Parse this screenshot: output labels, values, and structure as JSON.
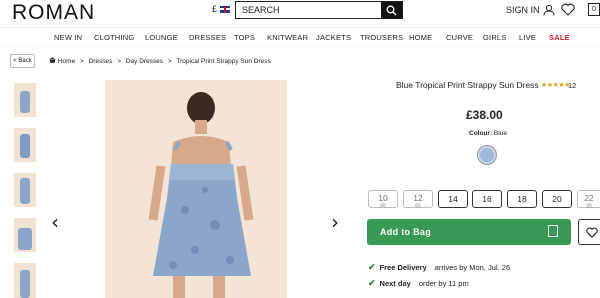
{
  "header": {
    "logo": "ROMAN",
    "currency": "£",
    "search_placeholder": "SEARCH",
    "signin": "SIGN IN",
    "bag_count": "0"
  },
  "nav": [
    "NEW IN",
    "CLOTHING",
    "LOUNGE",
    "DRESSES",
    "TOPS",
    "KNITWEAR",
    "JACKETS",
    "TROUSERS",
    "HOME",
    "CURVE",
    "GIRLS",
    "LIVE",
    "SALE"
  ],
  "breadcrumb": {
    "back": "< Back",
    "home": "Home",
    "sep": ">",
    "items": [
      "Dresses",
      "Day Dresses",
      "Tropical Print Strappy Sun Dress"
    ]
  },
  "product": {
    "title": "Blue Tropical Print Strappy Sun Dress",
    "rating_stars": "★★★★★",
    "review_count": "12",
    "price": "£38.00",
    "colour_label": "Colour:",
    "colour_value": "Blue",
    "sizes": [
      {
        "label": "10",
        "out_of_stock": true
      },
      {
        "label": "12",
        "out_of_stock": true
      },
      {
        "label": "14",
        "out_of_stock": false
      },
      {
        "label": "16",
        "out_of_stock": false
      },
      {
        "label": "18",
        "out_of_stock": false
      },
      {
        "label": "20",
        "out_of_stock": false
      },
      {
        "label": "22",
        "out_of_stock": true
      }
    ],
    "add_to_bag": "Add to Bag",
    "delivery": [
      {
        "title": "Free Delivery",
        "detail": "arrives by Mon, Jul. 26"
      },
      {
        "title": "Next day",
        "detail": "order by 11 pm"
      }
    ]
  },
  "colors": {
    "accent_green": "#399a55",
    "sale_red": "#d21e2b",
    "dress_blue": "#8aa6c8"
  }
}
